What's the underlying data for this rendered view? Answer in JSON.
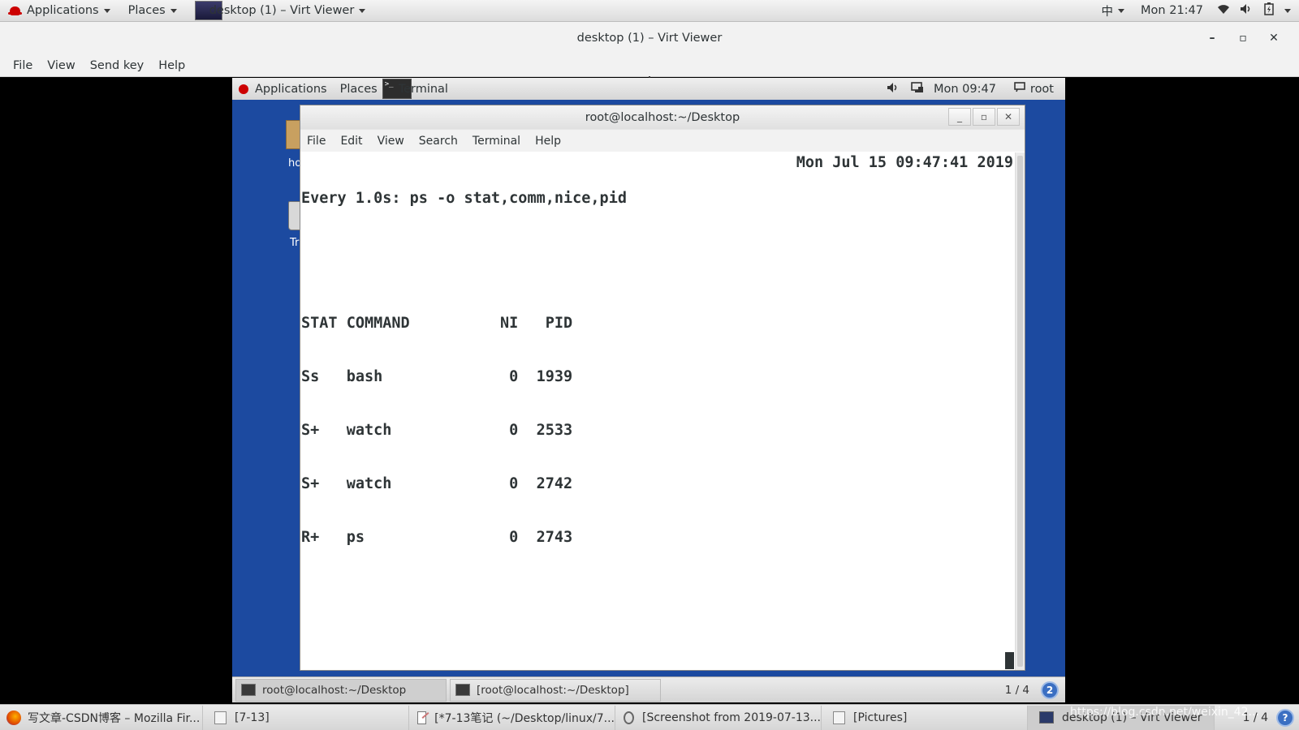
{
  "host_topbar": {
    "applications": "Applications",
    "places": "Places",
    "window": "desktop (1) – Virt Viewer",
    "input_method": "中",
    "clock": "Mon 21:47"
  },
  "virt_viewer": {
    "title": "desktop (1) – Virt Viewer",
    "menu": [
      "File",
      "View",
      "Send key",
      "Help"
    ]
  },
  "guest": {
    "topbar": {
      "applications": "Applications",
      "places": "Places",
      "terminal": "Terminal",
      "clock": "Mon 09:47",
      "user": "root"
    },
    "desktop_icons": [
      {
        "label": "ho"
      },
      {
        "label": "Tr"
      }
    ],
    "terminal": {
      "title": "root@localhost:~/Desktop",
      "menu": [
        "File",
        "Edit",
        "View",
        "Search",
        "Terminal",
        "Help"
      ],
      "header_left": "Every 1.0s: ps -o stat,comm,nice,pid",
      "header_right": "Mon Jul 15 09:47:41 2019",
      "columns": "STAT COMMAND          NI   PID",
      "rows": [
        "Ss   bash              0  1939",
        "S+   watch             0  2533",
        "S+   watch             0  2742",
        "R+   ps                0  2743"
      ]
    },
    "taskbar": {
      "tasks": [
        "root@localhost:~/Desktop",
        "[root@localhost:~/Desktop]"
      ],
      "pager": "1 / 4",
      "badge": "2"
    }
  },
  "host_taskbar": {
    "tasks": [
      "写文章-CSDN博客 – Mozilla Fir...",
      "[7-13]",
      "[*7-13笔记 (~/Desktop/linux/7...",
      "[Screenshot from 2019-07-13...",
      "[Pictures]",
      "desktop (1) – Virt Viewer"
    ],
    "pager": "1 / 4",
    "watermark": "https://blog.csdn.net/weixin_42..."
  },
  "colors": {
    "guest_desktop": "#1c4aa0",
    "pager_badge": "#3b6fc2"
  }
}
